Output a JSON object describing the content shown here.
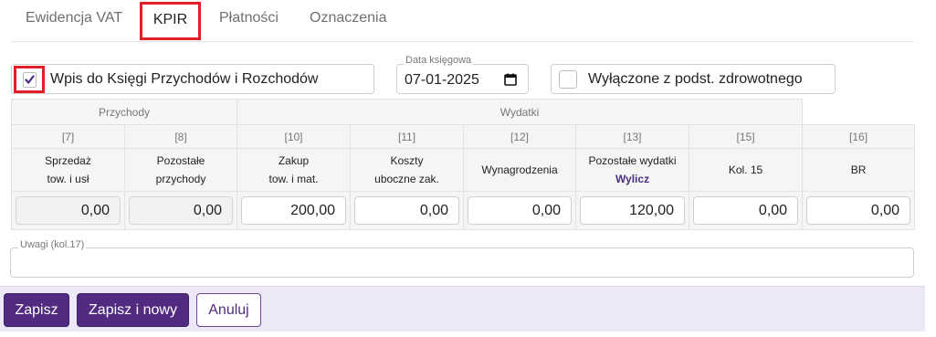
{
  "tabs": [
    {
      "label": "Ewidencja VAT"
    },
    {
      "label": "KPIR"
    },
    {
      "label": "Płatności"
    },
    {
      "label": "Oznaczenia"
    }
  ],
  "entry_checkbox": {
    "label": "Wpis do Księgi Przychodów i Rozchodów",
    "checked": true
  },
  "date_field": {
    "legend": "Data księgowa",
    "value": "07-01-2025"
  },
  "excluded_checkbox": {
    "label": "Wyłączone z podst. zdrowotnego",
    "checked": false
  },
  "grid": {
    "groups": [
      "Przychody",
      "Wydatki"
    ],
    "columns": [
      {
        "num": "[7]",
        "title1": "Sprzedaż",
        "title2": "tow. i usł",
        "value": "0,00",
        "readonly": true
      },
      {
        "num": "[8]",
        "title1": "Pozostałe",
        "title2": "przychody",
        "value": "0,00",
        "readonly": true
      },
      {
        "num": "[10]",
        "title1": "Zakup",
        "title2": "tow. i mat.",
        "value": "200,00",
        "readonly": false
      },
      {
        "num": "[11]",
        "title1": "Koszty",
        "title2": "uboczne zak.",
        "value": "0,00",
        "readonly": false
      },
      {
        "num": "[12]",
        "title1": "Wynagrodzenia",
        "title2": "",
        "value": "0,00",
        "readonly": false
      },
      {
        "num": "[13]",
        "title1": "Pozostałe wydatki",
        "title2": "Wylicz",
        "value": "120,00",
        "readonly": false
      },
      {
        "num": "[15]",
        "title1": "Kol. 15",
        "title2": "",
        "value": "0,00",
        "readonly": false
      },
      {
        "num": "[16]",
        "title1": "BR",
        "title2": "",
        "value": "0,00",
        "readonly": false
      }
    ]
  },
  "remarks": {
    "legend": "Uwagi (kol.17)",
    "value": ""
  },
  "footer": {
    "save": "Zapisz",
    "save_new": "Zapisz i nowy",
    "cancel": "Anuluj"
  },
  "colors": {
    "accent": "#512b80",
    "highlight": "#e01f26",
    "footer_bg": "#ede8f5"
  }
}
